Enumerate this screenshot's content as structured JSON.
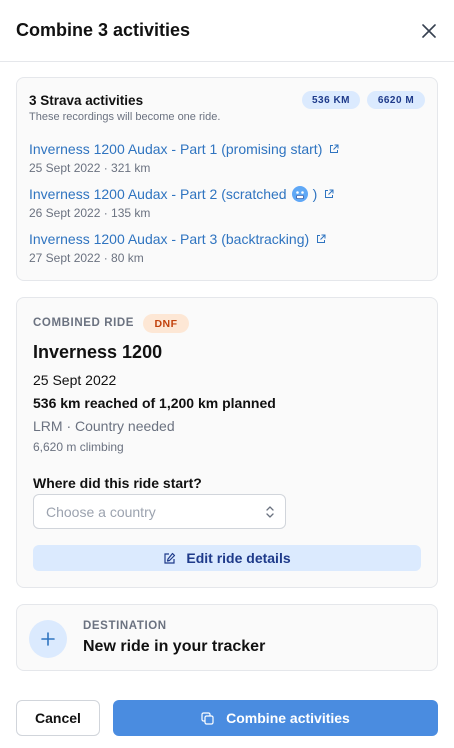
{
  "dialog": {
    "title": "Combine 3 activities"
  },
  "sources": {
    "title": "3 Strava activities",
    "subtitle": "These recordings will become one ride.",
    "total_distance": "536 KM",
    "total_elevation": "6620 M",
    "activities": [
      {
        "name": "Inverness 1200 Audax - Part 1 (promising start)",
        "meta": "25 Sept 2022 · 321 km"
      },
      {
        "name": "Inverness 1200 Audax - Part 2 (scratched",
        "emoji_icon": "cold-face-emoji",
        "meta": "26 Sept 2022 · 135 km"
      },
      {
        "name": "Inverness 1200 Audax - Part 3 (backtracking)",
        "meta": "27 Sept 2022 · 80 km"
      }
    ]
  },
  "combined": {
    "label": "COMBINED RIDE",
    "status": "DNF",
    "ride_name": "Inverness 1200",
    "date": "25 Sept 2022",
    "distance_summary": "536 km reached of 1,200 km planned",
    "meta": "LRM · Country needed",
    "climbing": "6,620 m climbing",
    "start_question": "Where did this ride start?",
    "country_placeholder": "Choose a country",
    "edit_label": "Edit ride details"
  },
  "destination": {
    "label": "DESTINATION",
    "value": "New ride in your tracker"
  },
  "footer": {
    "cancel_label": "Cancel",
    "combine_label": "Combine activities"
  },
  "colors": {
    "accent": "#4a8ce0",
    "link": "#2f74c0",
    "pill_bg": "#dbeafe",
    "dnf_bg": "#fde7d5",
    "dnf_text": "#c2410c"
  },
  "icons": {
    "close": "close-icon",
    "external_link": "external-link-icon",
    "select": "chevron-up-down-icon",
    "edit": "edit-icon",
    "add": "plus-icon",
    "combine": "copy-icon"
  }
}
